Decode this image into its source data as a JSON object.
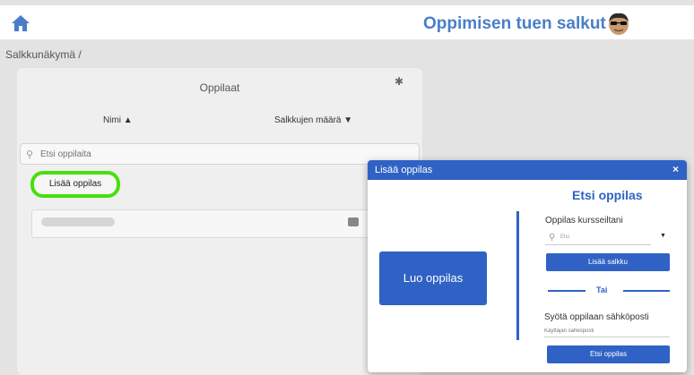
{
  "header": {
    "app_title": "Oppimisen tuen salkut",
    "home_icon": "home-icon",
    "avatar_icon": "emoji-sunglasses-icon",
    "accent_color": "#4a7ec8"
  },
  "breadcrumb": "Salkkunäkymä /",
  "students_panel": {
    "title": "Oppilaat",
    "settings_icon": "gear-icon",
    "col_name": "Nimi ▲",
    "col_portfolio_count": "Salkkujen määrä ▼",
    "search_placeholder": "Etsi oppilaita",
    "add_student": "Lisää oppilas",
    "highlight_color": "#4ade10"
  },
  "modal": {
    "title": "Lisää oppilas",
    "close": "×",
    "create_student": "Luo oppilas",
    "find_title": "Etsi oppilas",
    "from_courses_label": "Oppilas kursseiltani",
    "select_placeholder": "Etsi",
    "add_portfolio": "Lisää salkku",
    "or": "Tai",
    "email_label": "Syötä oppilaan sähköposti",
    "email_placeholder": "Käyttäjän sähköposti",
    "find_button": "Etsi oppilas",
    "primary_color": "#2f62c4"
  }
}
